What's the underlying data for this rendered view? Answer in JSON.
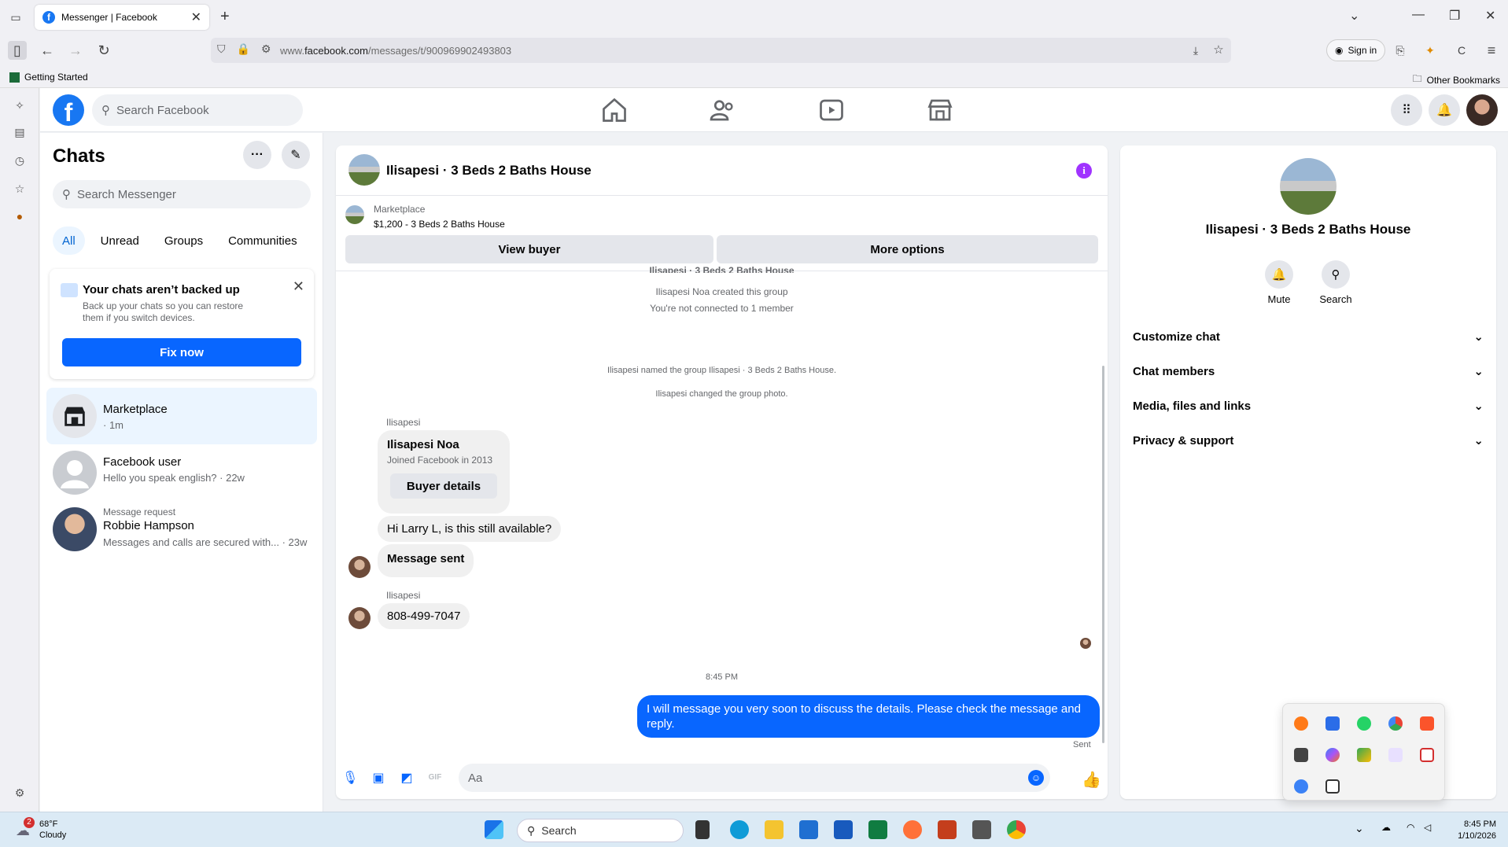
{
  "browser": {
    "tab_title": "Messenger | Facebook",
    "url_prefix": "www.",
    "url_domain": "facebook.com",
    "url_path": "/messages/t/900969902493803",
    "sign_in": "Sign in",
    "bookmark_left": "Getting Started",
    "bookmark_right": "Other Bookmarks"
  },
  "fb": {
    "logo_letter": "f",
    "search_placeholder": "Search Facebook"
  },
  "chats": {
    "title": "Chats",
    "search_placeholder": "Search Messenger",
    "filters": [
      "All",
      "Unread",
      "Groups",
      "Communities"
    ],
    "backup": {
      "title": "Your chats aren’t backed up",
      "body": "Back up your chats so you can restore them if you switch devices.",
      "button": "Fix now"
    },
    "items": [
      {
        "name": "Marketplace",
        "sub": "· 1m"
      },
      {
        "name": "Facebook user",
        "sub": "Hello you speak english? · 22w"
      },
      {
        "request": "Message request",
        "name": "Robbie Hampson",
        "sub": "Messages and calls are secured with... · 23w"
      }
    ]
  },
  "conversation": {
    "title": "Ilisapesi · 3 Beds 2 Baths House",
    "marketplace_label": "Marketplace",
    "listing": "$1,200 - 3 Beds 2 Baths House",
    "view_buyer": "View buyer",
    "more_options": "More options",
    "system": [
      "Ilisapesi · 3 Beds 2 Baths House",
      "Ilisapesi Noa created this group",
      "You're not connected to 1 member",
      "Ilisapesi named the group Ilisapesi · 3 Beds 2 Baths House.",
      "Ilisapesi changed the group photo."
    ],
    "sender_1": "Ilisapesi",
    "card_name": "Ilisapesi Noa",
    "card_sub": "Joined Facebook in 2013",
    "card_button": "Buyer details",
    "msg_1": "Hi Larry L, is this still available?",
    "msg_2": "Message sent",
    "sender_2": "Ilisapesi",
    "msg_3": "808-499-7047",
    "time": "8:45 PM",
    "my_msg": "I will message you very soon to discuss the details. Please check the message and reply.",
    "sent": "Sent",
    "composer_placeholder": "Aa"
  },
  "details": {
    "name": "Ilisapesi · 3 Beds 2 Baths House",
    "mute": "Mute",
    "search": "Search",
    "sections": [
      "Customize chat",
      "Chat members",
      "Media, files and links",
      "Privacy & support"
    ]
  },
  "taskbar": {
    "temp": "68°F",
    "condition": "Cloudy",
    "weather_badge": "2",
    "search": "Search",
    "time": "8:45 PM",
    "date": "1/10/2026"
  },
  "colors": {
    "fb_blue": "#0866ff",
    "selected_bg": "#ebf5ff",
    "info_purple": "#a033ff"
  }
}
